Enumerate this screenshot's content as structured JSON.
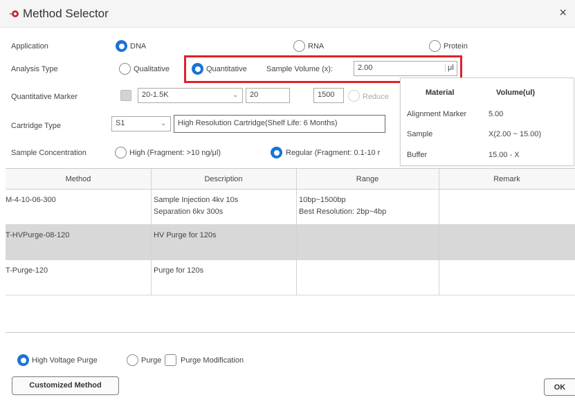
{
  "window": {
    "title": "Method Selector",
    "close_glyph": "×",
    "icon": "app-logo-icon"
  },
  "application": {
    "label": "Application",
    "options": [
      {
        "label": "DNA",
        "selected": true
      },
      {
        "label": "RNA",
        "selected": false
      },
      {
        "label": "Protein",
        "selected": false
      }
    ]
  },
  "analysis_type": {
    "label": "Analysis Type",
    "options": [
      {
        "label": "Qualitative",
        "selected": false
      },
      {
        "label": "Quantitative",
        "selected": true
      }
    ],
    "sample_volume_label": "Sample Volume (x):",
    "sample_volume_value": "2.00",
    "sample_volume_unit": "μl"
  },
  "quantitative_marker": {
    "label": "Quantitative Marker",
    "dropdown_value": "20-1.5K",
    "min_value": "20",
    "max_value": "1500",
    "reduce_label": "Reduce"
  },
  "cartridge_type": {
    "label": "Cartridge Type",
    "dropdown_value": "S1",
    "description": "High Resolution Cartridge(Shelf Life: 6 Months)"
  },
  "sample_concentration": {
    "label": "Sample Concentration",
    "options": [
      {
        "label": "High (Fragment: >10 ng/μl)",
        "selected": false
      },
      {
        "label": "Regular (Fragment: 0.1-10 r",
        "selected": true
      }
    ]
  },
  "volume_popup": {
    "headers": [
      "Material",
      "Volume(ul)"
    ],
    "rows": [
      {
        "material": "Alignment Marker",
        "volume": "5.00"
      },
      {
        "material": "Sample",
        "volume": "X(2.00 ~ 15.00)"
      },
      {
        "material": "Buffer",
        "volume": "15.00 - X"
      }
    ]
  },
  "table": {
    "columns": [
      "Method",
      "Description",
      "Range",
      "Remark"
    ],
    "rows": [
      {
        "method": "M-4-10-06-300",
        "description": [
          "Sample Injection 4kv 10s",
          "Separation 6kv 300s"
        ],
        "range": [
          "10bp~1500bp",
          "Best Resolution: 2bp~4bp"
        ],
        "remark": "",
        "selected": false
      },
      {
        "method": "T-HVPurge-08-120",
        "description": [
          "HV Purge for 120s"
        ],
        "range": [
          ""
        ],
        "remark": "",
        "selected": true
      },
      {
        "method": "T-Purge-120",
        "description": [
          "Purge for 120s"
        ],
        "range": [
          ""
        ],
        "remark": "",
        "selected": false
      }
    ]
  },
  "purge_options": [
    {
      "label": "High Voltage Purge",
      "type": "radio",
      "selected": true
    },
    {
      "label": "Purge",
      "type": "radio",
      "selected": false
    },
    {
      "label": "Purge Modification",
      "type": "checkbox",
      "selected": false
    }
  ],
  "buttons": {
    "customized": "Customized Method",
    "ok": "OK"
  },
  "colors": {
    "accent": "#1a73d6",
    "highlight": "#e0202a",
    "selected_row": "#d8d8d8"
  }
}
